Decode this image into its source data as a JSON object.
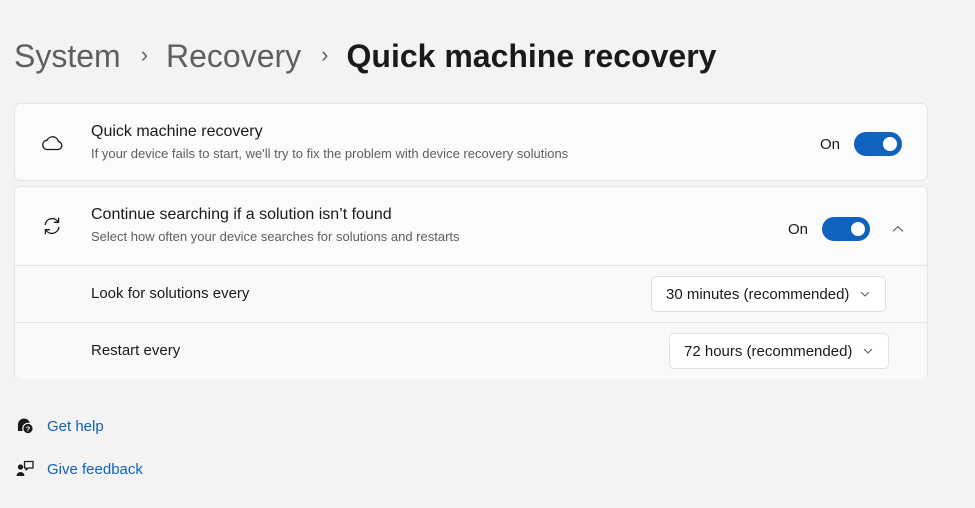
{
  "breadcrumb": {
    "items": [
      "System",
      "Recovery"
    ],
    "separator": "›",
    "current": "Quick machine recovery"
  },
  "settings": {
    "quick_recovery": {
      "icon": "cloud-icon",
      "title": "Quick machine recovery",
      "description": "If your device fails to start, we'll try to fix the problem with device recovery solutions",
      "toggle_state": "On",
      "toggle_on": true
    },
    "continue_searching": {
      "icon": "refresh-icon",
      "title": "Continue searching if a solution isn’t found",
      "description": "Select how often your device searches for solutions and restarts",
      "toggle_state": "On",
      "toggle_on": true,
      "expanded": true,
      "expand_icon": "chevron-up-icon",
      "options": [
        {
          "label": "Look for solutions every",
          "value": "30 minutes (recommended)"
        },
        {
          "label": "Restart every",
          "value": "72 hours (recommended)"
        }
      ]
    }
  },
  "links": [
    {
      "icon": "help-icon",
      "label": "Get help"
    },
    {
      "icon": "feedback-icon",
      "label": "Give feedback"
    }
  ],
  "colors": {
    "accent": "#0f62be",
    "background": "#f3f3f3",
    "card": "#fbfbfb"
  }
}
